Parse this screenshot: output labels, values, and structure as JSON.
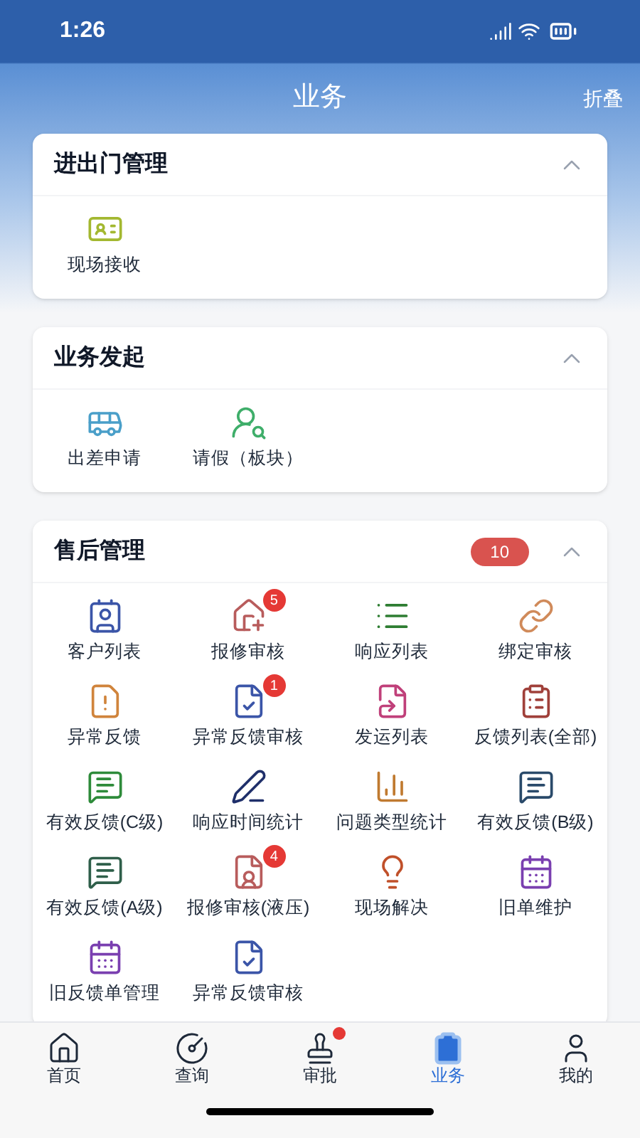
{
  "status_bar": {
    "time": "1:26"
  },
  "header": {
    "title": "业务",
    "action": "折叠"
  },
  "sections": [
    {
      "title": "进出门管理",
      "expanded": true,
      "items": [
        {
          "label": "现场接收"
        }
      ]
    },
    {
      "title": "业务发起",
      "expanded": true,
      "items": [
        {
          "label": "出差申请"
        },
        {
          "label": "请假（板块）"
        }
      ]
    },
    {
      "title": "售后管理",
      "expanded": true,
      "badge": "10",
      "items": [
        {
          "label": "客户列表"
        },
        {
          "label": "报修审核",
          "badge": "5"
        },
        {
          "label": "响应列表"
        },
        {
          "label": "绑定审核"
        },
        {
          "label": "异常反馈"
        },
        {
          "label": "异常反馈审核",
          "badge": "1"
        },
        {
          "label": "发运列表"
        },
        {
          "label": "反馈列表(全部)"
        },
        {
          "label": "有效反馈(C级)"
        },
        {
          "label": "响应时间统计"
        },
        {
          "label": "问题类型统计"
        },
        {
          "label": "有效反馈(B级)"
        },
        {
          "label": "有效反馈(A级)"
        },
        {
          "label": "报修审核(液压)",
          "badge": "4"
        },
        {
          "label": "现场解决"
        },
        {
          "label": "旧单维护"
        },
        {
          "label": "旧反馈单管理"
        },
        {
          "label": "异常反馈审核"
        }
      ]
    }
  ],
  "tab_bar": [
    {
      "label": "首页",
      "selected": false,
      "dot": false
    },
    {
      "label": "查询",
      "selected": false,
      "dot": false
    },
    {
      "label": "审批",
      "selected": false,
      "dot": true
    },
    {
      "label": "业务",
      "selected": true,
      "dot": false
    },
    {
      "label": "我的",
      "selected": false,
      "dot": false
    }
  ]
}
